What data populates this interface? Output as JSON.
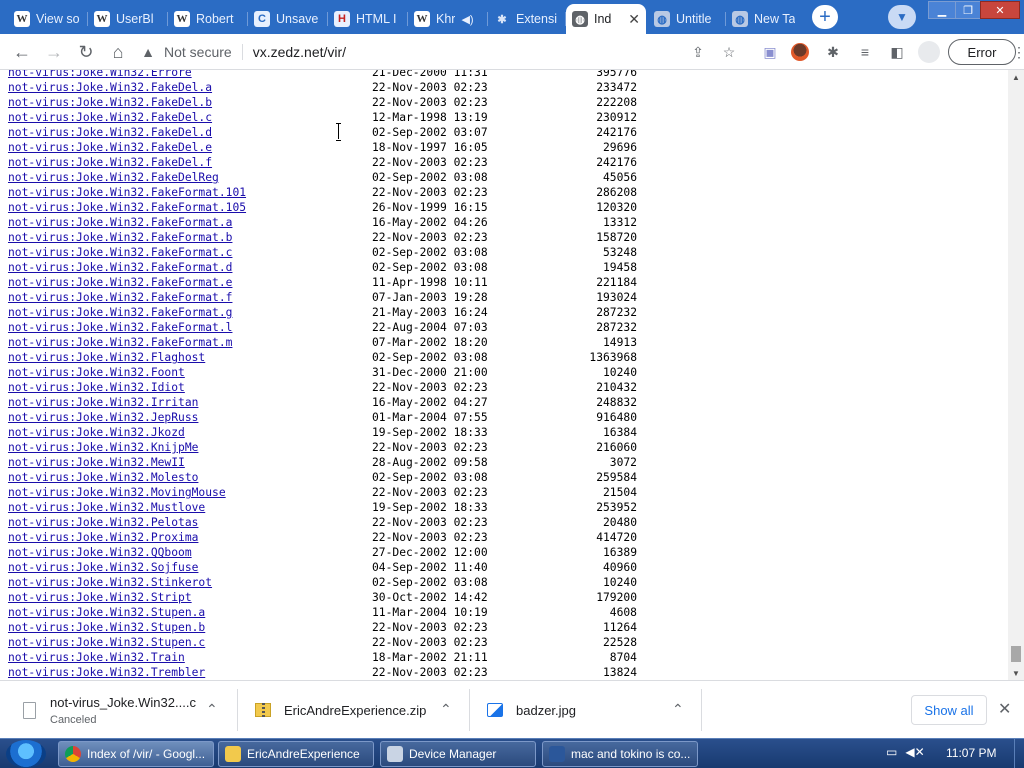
{
  "tabs": [
    {
      "label": "View so",
      "icon": "W"
    },
    {
      "label": "UserBl",
      "icon": "W"
    },
    {
      "label": "Robert",
      "icon": "W"
    },
    {
      "label": "Unsave",
      "icon": "C"
    },
    {
      "label": "HTML I",
      "icon": "H"
    },
    {
      "label": "Khr",
      "icon": "W"
    },
    {
      "label": "Extensi",
      "icon": "✱"
    },
    {
      "label": "Ind",
      "icon": "◍"
    },
    {
      "label": "Untitle",
      "icon": "◍"
    },
    {
      "label": "New Ta",
      "icon": "◍"
    }
  ],
  "toolbar": {
    "security_label": "Not secure",
    "url": "vx.zedz.net/vir/",
    "error_label": "Error"
  },
  "listing": [
    {
      "name": "not-virus:Joke.Win32.Errore",
      "date": "21-Dec-2000 11:31",
      "size": "395776"
    },
    {
      "name": "not-virus:Joke.Win32.FakeDel.a",
      "date": "22-Nov-2003 02:23",
      "size": "233472"
    },
    {
      "name": "not-virus:Joke.Win32.FakeDel.b",
      "date": "22-Nov-2003 02:23",
      "size": "222208"
    },
    {
      "name": "not-virus:Joke.Win32.FakeDel.c",
      "date": "12-Mar-1998 13:19",
      "size": "230912"
    },
    {
      "name": "not-virus:Joke.Win32.FakeDel.d",
      "date": "02-Sep-2002 03:07",
      "size": "242176"
    },
    {
      "name": "not-virus:Joke.Win32.FakeDel.e",
      "date": "18-Nov-1997 16:05",
      "size": "29696"
    },
    {
      "name": "not-virus:Joke.Win32.FakeDel.f",
      "date": "22-Nov-2003 02:23",
      "size": "242176"
    },
    {
      "name": "not-virus:Joke.Win32.FakeDelReg",
      "date": "02-Sep-2002 03:08",
      "size": "45056"
    },
    {
      "name": "not-virus:Joke.Win32.FakeFormat.101",
      "date": "22-Nov-2003 02:23",
      "size": "286208"
    },
    {
      "name": "not-virus:Joke.Win32.FakeFormat.105",
      "date": "26-Nov-1999 16:15",
      "size": "120320"
    },
    {
      "name": "not-virus:Joke.Win32.FakeFormat.a",
      "date": "16-May-2002 04:26",
      "size": "13312"
    },
    {
      "name": "not-virus:Joke.Win32.FakeFormat.b",
      "date": "22-Nov-2003 02:23",
      "size": "158720"
    },
    {
      "name": "not-virus:Joke.Win32.FakeFormat.c",
      "date": "02-Sep-2002 03:08",
      "size": "53248"
    },
    {
      "name": "not-virus:Joke.Win32.FakeFormat.d",
      "date": "02-Sep-2002 03:08",
      "size": "19458"
    },
    {
      "name": "not-virus:Joke.Win32.FakeFormat.e",
      "date": "11-Apr-1998 10:11",
      "size": "221184"
    },
    {
      "name": "not-virus:Joke.Win32.FakeFormat.f",
      "date": "07-Jan-2003 19:28",
      "size": "193024"
    },
    {
      "name": "not-virus:Joke.Win32.FakeFormat.g",
      "date": "21-May-2003 16:24",
      "size": "287232"
    },
    {
      "name": "not-virus:Joke.Win32.FakeFormat.l",
      "date": "22-Aug-2004 07:03",
      "size": "287232"
    },
    {
      "name": "not-virus:Joke.Win32.FakeFormat.m",
      "date": "07-Mar-2002 18:20",
      "size": "14913"
    },
    {
      "name": "not-virus:Joke.Win32.Flaghost",
      "date": "02-Sep-2002 03:08",
      "size": "1363968"
    },
    {
      "name": "not-virus:Joke.Win32.Foont",
      "date": "31-Dec-2000 21:00",
      "size": "10240"
    },
    {
      "name": "not-virus:Joke.Win32.Idiot",
      "date": "22-Nov-2003 02:23",
      "size": "210432"
    },
    {
      "name": "not-virus:Joke.Win32.Irritan",
      "date": "16-May-2002 04:27",
      "size": "248832"
    },
    {
      "name": "not-virus:Joke.Win32.JepRuss",
      "date": "01-Mar-2004 07:55",
      "size": "916480"
    },
    {
      "name": "not-virus:Joke.Win32.Jkozd",
      "date": "19-Sep-2002 18:33",
      "size": "16384"
    },
    {
      "name": "not-virus:Joke.Win32.KnijpMe",
      "date": "22-Nov-2003 02:23",
      "size": "216060"
    },
    {
      "name": "not-virus:Joke.Win32.MewII",
      "date": "28-Aug-2002 09:58",
      "size": "3072"
    },
    {
      "name": "not-virus:Joke.Win32.Molesto",
      "date": "02-Sep-2002 03:08",
      "size": "259584"
    },
    {
      "name": "not-virus:Joke.Win32.MovingMouse",
      "date": "22-Nov-2003 02:23",
      "size": "21504"
    },
    {
      "name": "not-virus:Joke.Win32.Mustlove",
      "date": "19-Sep-2002 18:33",
      "size": "253952"
    },
    {
      "name": "not-virus:Joke.Win32.Pelotas",
      "date": "22-Nov-2003 02:23",
      "size": "20480"
    },
    {
      "name": "not-virus:Joke.Win32.Proxima",
      "date": "22-Nov-2003 02:23",
      "size": "414720"
    },
    {
      "name": "not-virus:Joke.Win32.QQboom",
      "date": "27-Dec-2002 12:00",
      "size": "16389"
    },
    {
      "name": "not-virus:Joke.Win32.Sojfuse",
      "date": "04-Sep-2002 11:40",
      "size": "40960"
    },
    {
      "name": "not-virus:Joke.Win32.Stinkerot",
      "date": "02-Sep-2002 03:08",
      "size": "10240"
    },
    {
      "name": "not-virus:Joke.Win32.Stript",
      "date": "30-Oct-2002 14:42",
      "size": "179200"
    },
    {
      "name": "not-virus:Joke.Win32.Stupen.a",
      "date": "11-Mar-2004 10:19",
      "size": "4608"
    },
    {
      "name": "not-virus:Joke.Win32.Stupen.b",
      "date": "22-Nov-2003 02:23",
      "size": "11264"
    },
    {
      "name": "not-virus:Joke.Win32.Stupen.c",
      "date": "22-Nov-2003 02:23",
      "size": "22528"
    },
    {
      "name": "not-virus:Joke.Win32.Train",
      "date": "18-Mar-2002 21:11",
      "size": "8704"
    },
    {
      "name": "not-virus:Joke.Win32.Trembler",
      "date": "22-Nov-2003 02:23",
      "size": "13824"
    }
  ],
  "downloads": {
    "items": [
      {
        "name": "not-virus_Joke.Win32....c",
        "status": "Canceled"
      },
      {
        "name": "EricAndreExperience.zip",
        "status": ""
      },
      {
        "name": "badzer.jpg",
        "status": ""
      }
    ],
    "show_all_label": "Show all"
  },
  "taskbar": {
    "items": [
      {
        "label": "Index of /vir/ - Googl..."
      },
      {
        "label": "EricAndreExperience"
      },
      {
        "label": "Device Manager"
      },
      {
        "label": "mac and tokino is co..."
      }
    ],
    "clock": "11:07 PM"
  }
}
